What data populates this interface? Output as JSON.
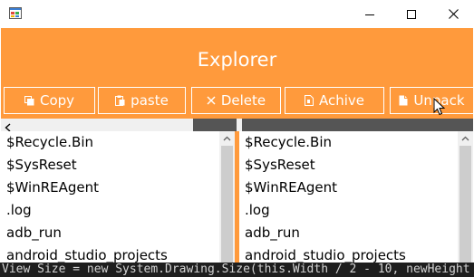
{
  "window": {
    "controls": {
      "minimize_icon": "minimize-icon",
      "maximize_icon": "maximize-icon",
      "close_icon": "close-icon"
    }
  },
  "header": {
    "title": "Explorer"
  },
  "toolbar": {
    "buttons": [
      {
        "label": "Copy",
        "icon": "copy-icon"
      },
      {
        "label": "paste",
        "icon": "paste-icon"
      },
      {
        "label": "Delete",
        "icon": "delete-icon"
      },
      {
        "label": "Achive",
        "icon": "archive-icon"
      },
      {
        "label": "Unpack",
        "icon": "unpack-icon"
      }
    ]
  },
  "left_pane": {
    "items": [
      "$Recycle.Bin",
      "$SysReset",
      "$WinREAgent",
      ".log",
      "adb_run",
      "android_studio_projects"
    ]
  },
  "right_pane": {
    "items": [
      "$Recycle.Bin",
      "$SysReset",
      "$WinREAgent",
      ".log",
      "adb_run",
      "android_studio_projects"
    ]
  },
  "background_code": {
    "text": "View Size = new System.Drawing.Size(this.Width / 2 - 10, newHeight"
  },
  "colors": {
    "accent": "#ff9a3c",
    "text_on_accent": "#ffffff",
    "scrollbar_track": "#f0f0f0",
    "scrollbar_thumb": "#cdcdcd",
    "splitter": "#555555"
  }
}
